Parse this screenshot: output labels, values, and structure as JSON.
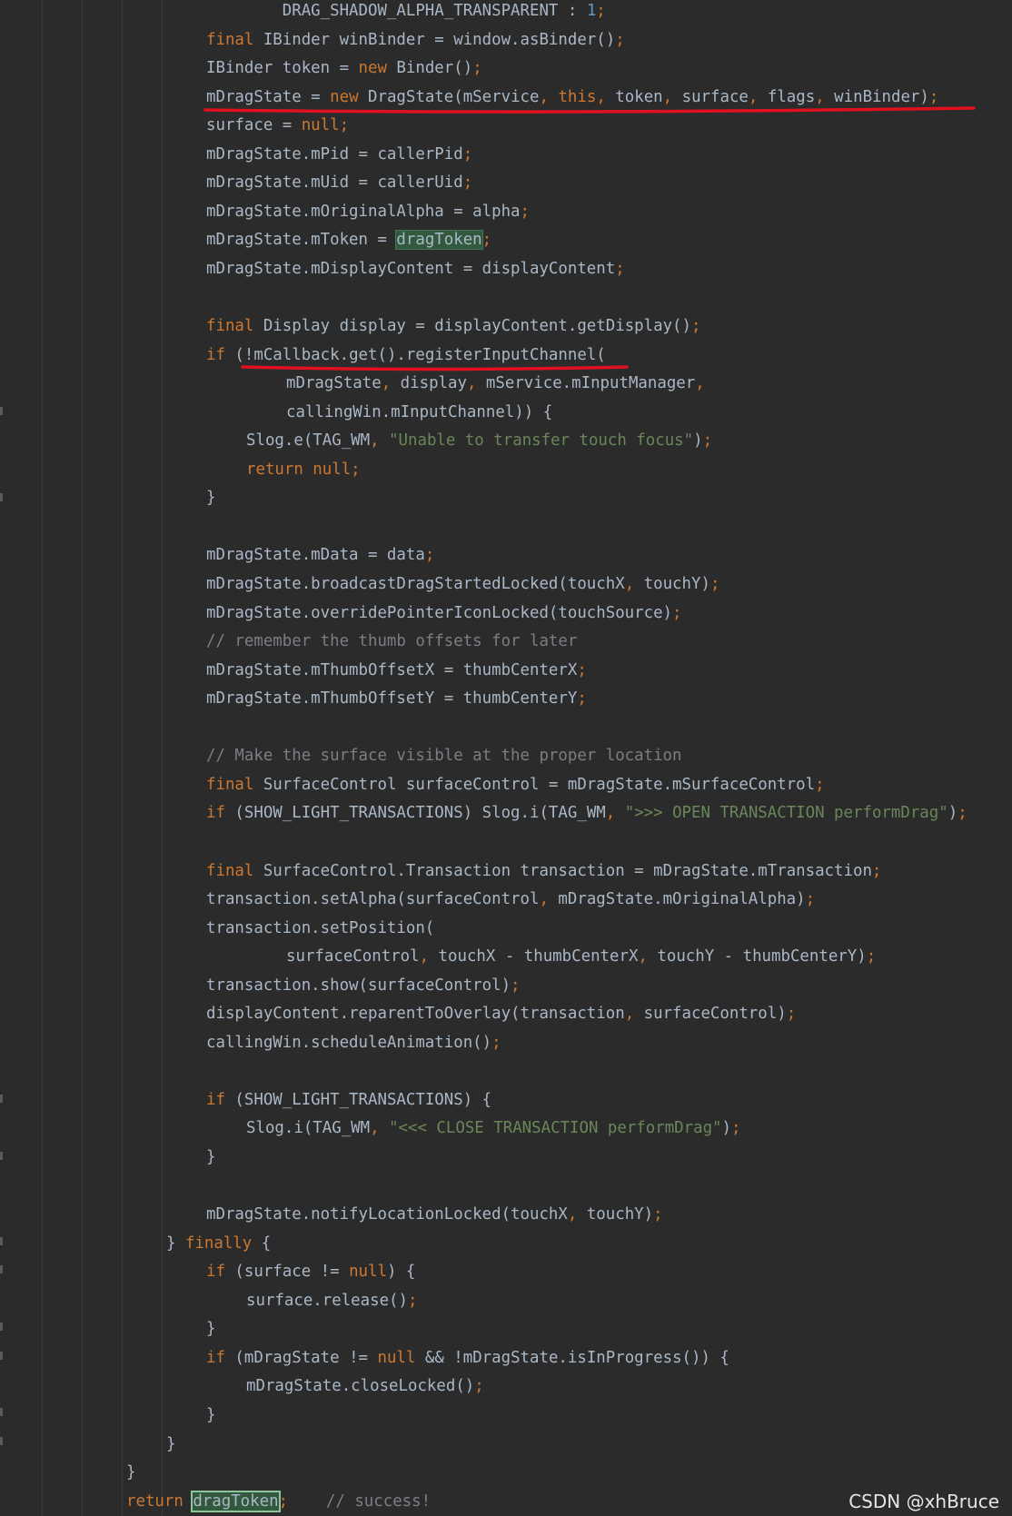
{
  "colors": {
    "background": "#2b2b2b",
    "default_text": "#a9b7c6",
    "keyword": "#cc7832",
    "string": "#6a8759",
    "comment": "#7a7e85",
    "number": "#6897bb",
    "highlight": "#32593d",
    "annotation_underline": "#e0101e"
  },
  "watermark": "CSDN @xhBruce",
  "code_lines": [
    {
      "indent": 0,
      "segments": [
        {
          "t": "        DRAG_SHADOW_ALPHA_TRANSPARENT : ",
          "c": "x"
        },
        {
          "t": "1",
          "c": "n"
        },
        {
          "t": ";",
          "c": "p"
        }
      ]
    },
    {
      "indent": 0,
      "segments": [
        {
          "t": "final",
          "c": "k"
        },
        {
          "t": " IBinder winBinder = window.asBinder()",
          "c": "x"
        },
        {
          "t": ";",
          "c": "p"
        }
      ]
    },
    {
      "indent": 0,
      "segments": [
        {
          "t": "IBinder token = ",
          "c": "x"
        },
        {
          "t": "new",
          "c": "k"
        },
        {
          "t": " Binder()",
          "c": "x"
        },
        {
          "t": ";",
          "c": "p"
        }
      ]
    },
    {
      "indent": 0,
      "segments": [
        {
          "t": "mDragState = ",
          "c": "x"
        },
        {
          "t": "new",
          "c": "k"
        },
        {
          "t": " DragState(mService",
          "c": "x"
        },
        {
          "t": ", ",
          "c": "p"
        },
        {
          "t": "this",
          "c": "k"
        },
        {
          "t": ", ",
          "c": "p"
        },
        {
          "t": "token",
          "c": "x"
        },
        {
          "t": ", ",
          "c": "p"
        },
        {
          "t": "surface",
          "c": "x"
        },
        {
          "t": ", ",
          "c": "p"
        },
        {
          "t": "flags",
          "c": "x"
        },
        {
          "t": ", ",
          "c": "p"
        },
        {
          "t": "winBinder)",
          "c": "x"
        },
        {
          "t": ";",
          "c": "p"
        }
      ]
    },
    {
      "indent": 0,
      "segments": [
        {
          "t": "surface = ",
          "c": "x"
        },
        {
          "t": "null",
          "c": "k"
        },
        {
          "t": ";",
          "c": "p"
        }
      ]
    },
    {
      "indent": 0,
      "segments": [
        {
          "t": "mDragState.mPid = callerPid",
          "c": "x"
        },
        {
          "t": ";",
          "c": "p"
        }
      ]
    },
    {
      "indent": 0,
      "segments": [
        {
          "t": "mDragState.mUid = callerUid",
          "c": "x"
        },
        {
          "t": ";",
          "c": "p"
        }
      ]
    },
    {
      "indent": 0,
      "segments": [
        {
          "t": "mDragState.mOriginalAlpha = alpha",
          "c": "x"
        },
        {
          "t": ";",
          "c": "p"
        }
      ]
    },
    {
      "indent": 0,
      "segments": [
        {
          "t": "mDragState.mToken = ",
          "c": "x"
        },
        {
          "t": "dragToken",
          "c": "h"
        },
        {
          "t": ";",
          "c": "p"
        }
      ]
    },
    {
      "indent": 0,
      "segments": [
        {
          "t": "mDragState.mDisplayContent = displayContent",
          "c": "x"
        },
        {
          "t": ";",
          "c": "p"
        }
      ]
    },
    {
      "indent": 0,
      "segments": []
    },
    {
      "indent": 0,
      "segments": [
        {
          "t": "final",
          "c": "k"
        },
        {
          "t": " Display display = displayContent.getDisplay()",
          "c": "x"
        },
        {
          "t": ";",
          "c": "p"
        }
      ]
    },
    {
      "indent": 0,
      "segments": [
        {
          "t": "if",
          "c": "k"
        },
        {
          "t": " (!mCallback.get().registerInputChannel(",
          "c": "x"
        }
      ]
    },
    {
      "indent": 2,
      "segments": [
        {
          "t": "mDragState",
          "c": "x"
        },
        {
          "t": ", ",
          "c": "p"
        },
        {
          "t": "display",
          "c": "x"
        },
        {
          "t": ", ",
          "c": "p"
        },
        {
          "t": "mService.mInputManager",
          "c": "x"
        },
        {
          "t": ",",
          "c": "p"
        }
      ]
    },
    {
      "indent": 2,
      "segments": [
        {
          "t": "callingWin.mInputChannel)) {",
          "c": "x"
        }
      ]
    },
    {
      "indent": 1,
      "segments": [
        {
          "t": "Slog.e(TAG_WM",
          "c": "x"
        },
        {
          "t": ", ",
          "c": "p"
        },
        {
          "t": "\"Unable to transfer touch focus\"",
          "c": "s"
        },
        {
          "t": ")",
          "c": "x"
        },
        {
          "t": ";",
          "c": "p"
        }
      ]
    },
    {
      "indent": 1,
      "segments": [
        {
          "t": "return null",
          "c": "k"
        },
        {
          "t": ";",
          "c": "p"
        }
      ]
    },
    {
      "indent": 0,
      "segments": [
        {
          "t": "}",
          "c": "x"
        }
      ]
    },
    {
      "indent": 0,
      "segments": []
    },
    {
      "indent": 0,
      "segments": [
        {
          "t": "mDragState.mData = data",
          "c": "x"
        },
        {
          "t": ";",
          "c": "p"
        }
      ]
    },
    {
      "indent": 0,
      "segments": [
        {
          "t": "mDragState.broadcastDragStartedLocked(touchX",
          "c": "x"
        },
        {
          "t": ", ",
          "c": "p"
        },
        {
          "t": "touchY)",
          "c": "x"
        },
        {
          "t": ";",
          "c": "p"
        }
      ]
    },
    {
      "indent": 0,
      "segments": [
        {
          "t": "mDragState.overridePointerIconLocked(touchSource)",
          "c": "x"
        },
        {
          "t": ";",
          "c": "p"
        }
      ]
    },
    {
      "indent": 0,
      "segments": [
        {
          "t": "// remember the thumb offsets for later",
          "c": "c"
        }
      ]
    },
    {
      "indent": 0,
      "segments": [
        {
          "t": "mDragState.mThumbOffsetX = thumbCenterX",
          "c": "x"
        },
        {
          "t": ";",
          "c": "p"
        }
      ]
    },
    {
      "indent": 0,
      "segments": [
        {
          "t": "mDragState.mThumbOffsetY = thumbCenterY",
          "c": "x"
        },
        {
          "t": ";",
          "c": "p"
        }
      ]
    },
    {
      "indent": 0,
      "segments": []
    },
    {
      "indent": 0,
      "segments": [
        {
          "t": "// Make the surface visible at the proper location",
          "c": "c"
        }
      ]
    },
    {
      "indent": 0,
      "segments": [
        {
          "t": "final",
          "c": "k"
        },
        {
          "t": " SurfaceControl surfaceControl = mDragState.mSurfaceControl",
          "c": "x"
        },
        {
          "t": ";",
          "c": "p"
        }
      ]
    },
    {
      "indent": 0,
      "segments": [
        {
          "t": "if",
          "c": "k"
        },
        {
          "t": " (SHOW_LIGHT_TRANSACTIONS) Slog.i(TAG_WM",
          "c": "x"
        },
        {
          "t": ", ",
          "c": "p"
        },
        {
          "t": "\">>> OPEN TRANSACTION performDrag\"",
          "c": "s"
        },
        {
          "t": ")",
          "c": "x"
        },
        {
          "t": ";",
          "c": "p"
        }
      ]
    },
    {
      "indent": 0,
      "segments": []
    },
    {
      "indent": 0,
      "segments": [
        {
          "t": "final",
          "c": "k"
        },
        {
          "t": " SurfaceControl.Transaction transaction = mDragState.mTransaction",
          "c": "x"
        },
        {
          "t": ";",
          "c": "p"
        }
      ]
    },
    {
      "indent": 0,
      "segments": [
        {
          "t": "transaction.setAlpha(surfaceControl",
          "c": "x"
        },
        {
          "t": ", ",
          "c": "p"
        },
        {
          "t": "mDragState.mOriginalAlpha)",
          "c": "x"
        },
        {
          "t": ";",
          "c": "p"
        }
      ]
    },
    {
      "indent": 0,
      "segments": [
        {
          "t": "transaction.setPosition(",
          "c": "x"
        }
      ]
    },
    {
      "indent": 2,
      "segments": [
        {
          "t": "surfaceControl",
          "c": "x"
        },
        {
          "t": ", ",
          "c": "p"
        },
        {
          "t": "touchX - thumbCenterX",
          "c": "x"
        },
        {
          "t": ", ",
          "c": "p"
        },
        {
          "t": "touchY - thumbCenterY)",
          "c": "x"
        },
        {
          "t": ";",
          "c": "p"
        }
      ]
    },
    {
      "indent": 0,
      "segments": [
        {
          "t": "transaction.show(surfaceControl)",
          "c": "x"
        },
        {
          "t": ";",
          "c": "p"
        }
      ]
    },
    {
      "indent": 0,
      "segments": [
        {
          "t": "displayContent.reparentToOverlay(transaction",
          "c": "x"
        },
        {
          "t": ", ",
          "c": "p"
        },
        {
          "t": "surfaceControl)",
          "c": "x"
        },
        {
          "t": ";",
          "c": "p"
        }
      ]
    },
    {
      "indent": 0,
      "segments": [
        {
          "t": "callingWin.scheduleAnimation()",
          "c": "x"
        },
        {
          "t": ";",
          "c": "p"
        }
      ]
    },
    {
      "indent": 0,
      "segments": []
    },
    {
      "indent": 0,
      "segments": [
        {
          "t": "if",
          "c": "k"
        },
        {
          "t": " (SHOW_LIGHT_TRANSACTIONS) {",
          "c": "x"
        }
      ]
    },
    {
      "indent": 1,
      "segments": [
        {
          "t": "Slog.i(TAG_WM",
          "c": "x"
        },
        {
          "t": ", ",
          "c": "p"
        },
        {
          "t": "\"<<< CLOSE TRANSACTION performDrag\"",
          "c": "s"
        },
        {
          "t": ")",
          "c": "x"
        },
        {
          "t": ";",
          "c": "p"
        }
      ]
    },
    {
      "indent": 0,
      "segments": [
        {
          "t": "}",
          "c": "x"
        }
      ]
    },
    {
      "indent": 0,
      "segments": []
    },
    {
      "indent": 0,
      "segments": [
        {
          "t": "mDragState.notifyLocationLocked(touchX",
          "c": "x"
        },
        {
          "t": ", ",
          "c": "p"
        },
        {
          "t": "touchY)",
          "c": "x"
        },
        {
          "t": ";",
          "c": "p"
        }
      ]
    },
    {
      "indent": -1,
      "segments": [
        {
          "t": "} ",
          "c": "x"
        },
        {
          "t": "finally",
          "c": "k"
        },
        {
          "t": " {",
          "c": "x"
        }
      ]
    },
    {
      "indent": 0,
      "segments": [
        {
          "t": "if",
          "c": "k"
        },
        {
          "t": " (surface != ",
          "c": "x"
        },
        {
          "t": "null",
          "c": "k"
        },
        {
          "t": ") {",
          "c": "x"
        }
      ]
    },
    {
      "indent": 1,
      "segments": [
        {
          "t": "surface.release()",
          "c": "x"
        },
        {
          "t": ";",
          "c": "p"
        }
      ]
    },
    {
      "indent": 0,
      "segments": [
        {
          "t": "}",
          "c": "x"
        }
      ]
    },
    {
      "indent": 0,
      "segments": [
        {
          "t": "if",
          "c": "k"
        },
        {
          "t": " (mDragState != ",
          "c": "x"
        },
        {
          "t": "null",
          "c": "k"
        },
        {
          "t": " && !mDragState.isInProgress()) {",
          "c": "x"
        }
      ]
    },
    {
      "indent": 1,
      "segments": [
        {
          "t": "mDragState.closeLocked()",
          "c": "x"
        },
        {
          "t": ";",
          "c": "p"
        }
      ]
    },
    {
      "indent": 0,
      "segments": [
        {
          "t": "}",
          "c": "x"
        }
      ]
    },
    {
      "indent": -1,
      "segments": [
        {
          "t": "}",
          "c": "x"
        }
      ]
    },
    {
      "indent": -2,
      "segments": [
        {
          "t": "}",
          "c": "x"
        }
      ]
    },
    {
      "indent": -2,
      "segments": [
        {
          "t": "return",
          "c": "k"
        },
        {
          "t": " ",
          "c": "x"
        },
        {
          "t": "dragToken",
          "c": "hs"
        },
        {
          "t": ";",
          "c": "p"
        },
        {
          "t": "    ",
          "c": "x"
        },
        {
          "t": "// success!",
          "c": "c"
        }
      ]
    }
  ]
}
